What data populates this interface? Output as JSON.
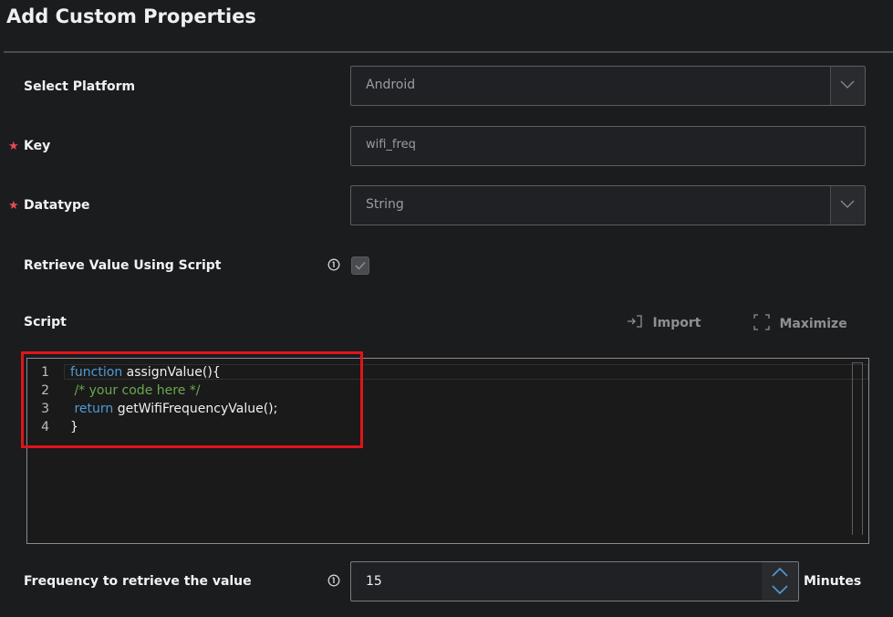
{
  "dialog": {
    "title": "Add Custom Properties"
  },
  "platform": {
    "label": "Select Platform",
    "value": "Android"
  },
  "key": {
    "label": "Key",
    "value": "wifi_freq"
  },
  "datatype": {
    "label": "Datatype",
    "value": "String"
  },
  "retrieve_script": {
    "label": "Retrieve Value Using Script",
    "checked": true
  },
  "script": {
    "label": "Script",
    "import_label": "Import",
    "maximize_label": "Maximize",
    "lines": [
      {
        "num": "1",
        "parts": [
          {
            "t": "function",
            "c": "kw"
          },
          {
            "t": " assignValue(){",
            "c": "fn"
          }
        ]
      },
      {
        "num": "2",
        "parts": [
          {
            "t": " /* your code here */",
            "c": "cm"
          }
        ]
      },
      {
        "num": "3",
        "parts": [
          {
            "t": " return",
            "c": "kw"
          },
          {
            "t": " getWifiFrequencyValue();",
            "c": "fn"
          }
        ]
      },
      {
        "num": "4",
        "parts": [
          {
            "t": "}",
            "c": "fn"
          }
        ]
      }
    ]
  },
  "frequency": {
    "label": "Frequency to retrieve the value",
    "value": "15",
    "unit": "Minutes"
  },
  "colors": {
    "required_marker": "#e64a5b",
    "keyword": "#4e9cd6",
    "comment": "#69a84f",
    "highlight_box": "#e0141b"
  }
}
